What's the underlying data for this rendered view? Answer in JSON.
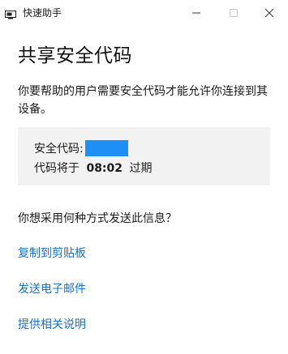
{
  "window": {
    "title": "快速助手",
    "icon": "quick-assist-icon",
    "buttons": [
      "minimize-icon",
      "maximize-icon",
      "close-icon"
    ]
  },
  "main": {
    "heading": "共享安全代码",
    "description": "你要帮助的用户需要安全代码才能允许你连接到其设备。",
    "code_box": {
      "code_label": "安全代码:",
      "code_value": "",
      "expiry_prefix": "代码将于",
      "expiry_time": "08:02",
      "expiry_suffix": "过期"
    },
    "question": "你想采用何种方式发送此信息？",
    "links": {
      "copy": "复制到剪贴板",
      "email": "发送电子邮件",
      "instructions": "提供相关说明"
    }
  },
  "colors": {
    "link": "#1a6fc1",
    "code_highlight": "#1e90f5",
    "code_box_bg": "#f2f2f2"
  }
}
